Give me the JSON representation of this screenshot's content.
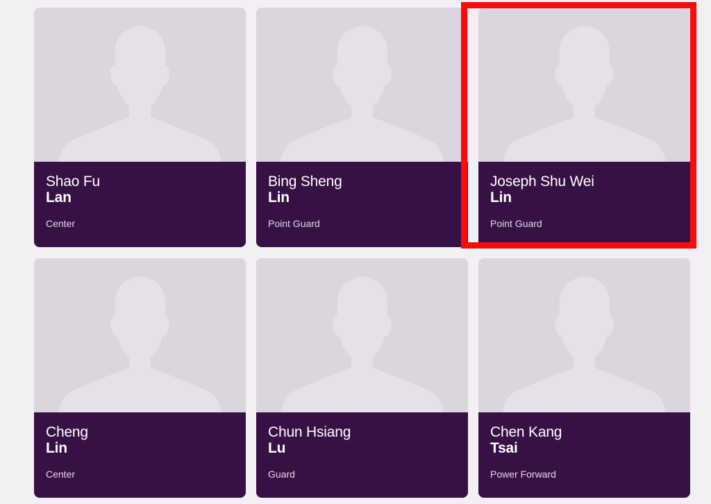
{
  "players": [
    {
      "first_name": "Shao Fu",
      "last_name": "Lan",
      "position": "Center"
    },
    {
      "first_name": "Bing Sheng",
      "last_name": "Lin",
      "position": "Point Guard"
    },
    {
      "first_name": "Joseph Shu Wei",
      "last_name": "Lin",
      "position": "Point Guard"
    },
    {
      "first_name": "Cheng",
      "last_name": "Lin",
      "position": "Center"
    },
    {
      "first_name": "Chun Hsiang",
      "last_name": "Lu",
      "position": "Guard"
    },
    {
      "first_name": "Chen Kang",
      "last_name": "Tsai",
      "position": "Power Forward"
    }
  ],
  "colors": {
    "page_background": "#f2f0f3",
    "photo_background": "#dbd5de",
    "silhouette": "#e6e1e8",
    "info_background": "#371145",
    "highlight_border": "#ff0a0a"
  },
  "icons": {
    "placeholder_photo": "person-silhouette-icon"
  }
}
